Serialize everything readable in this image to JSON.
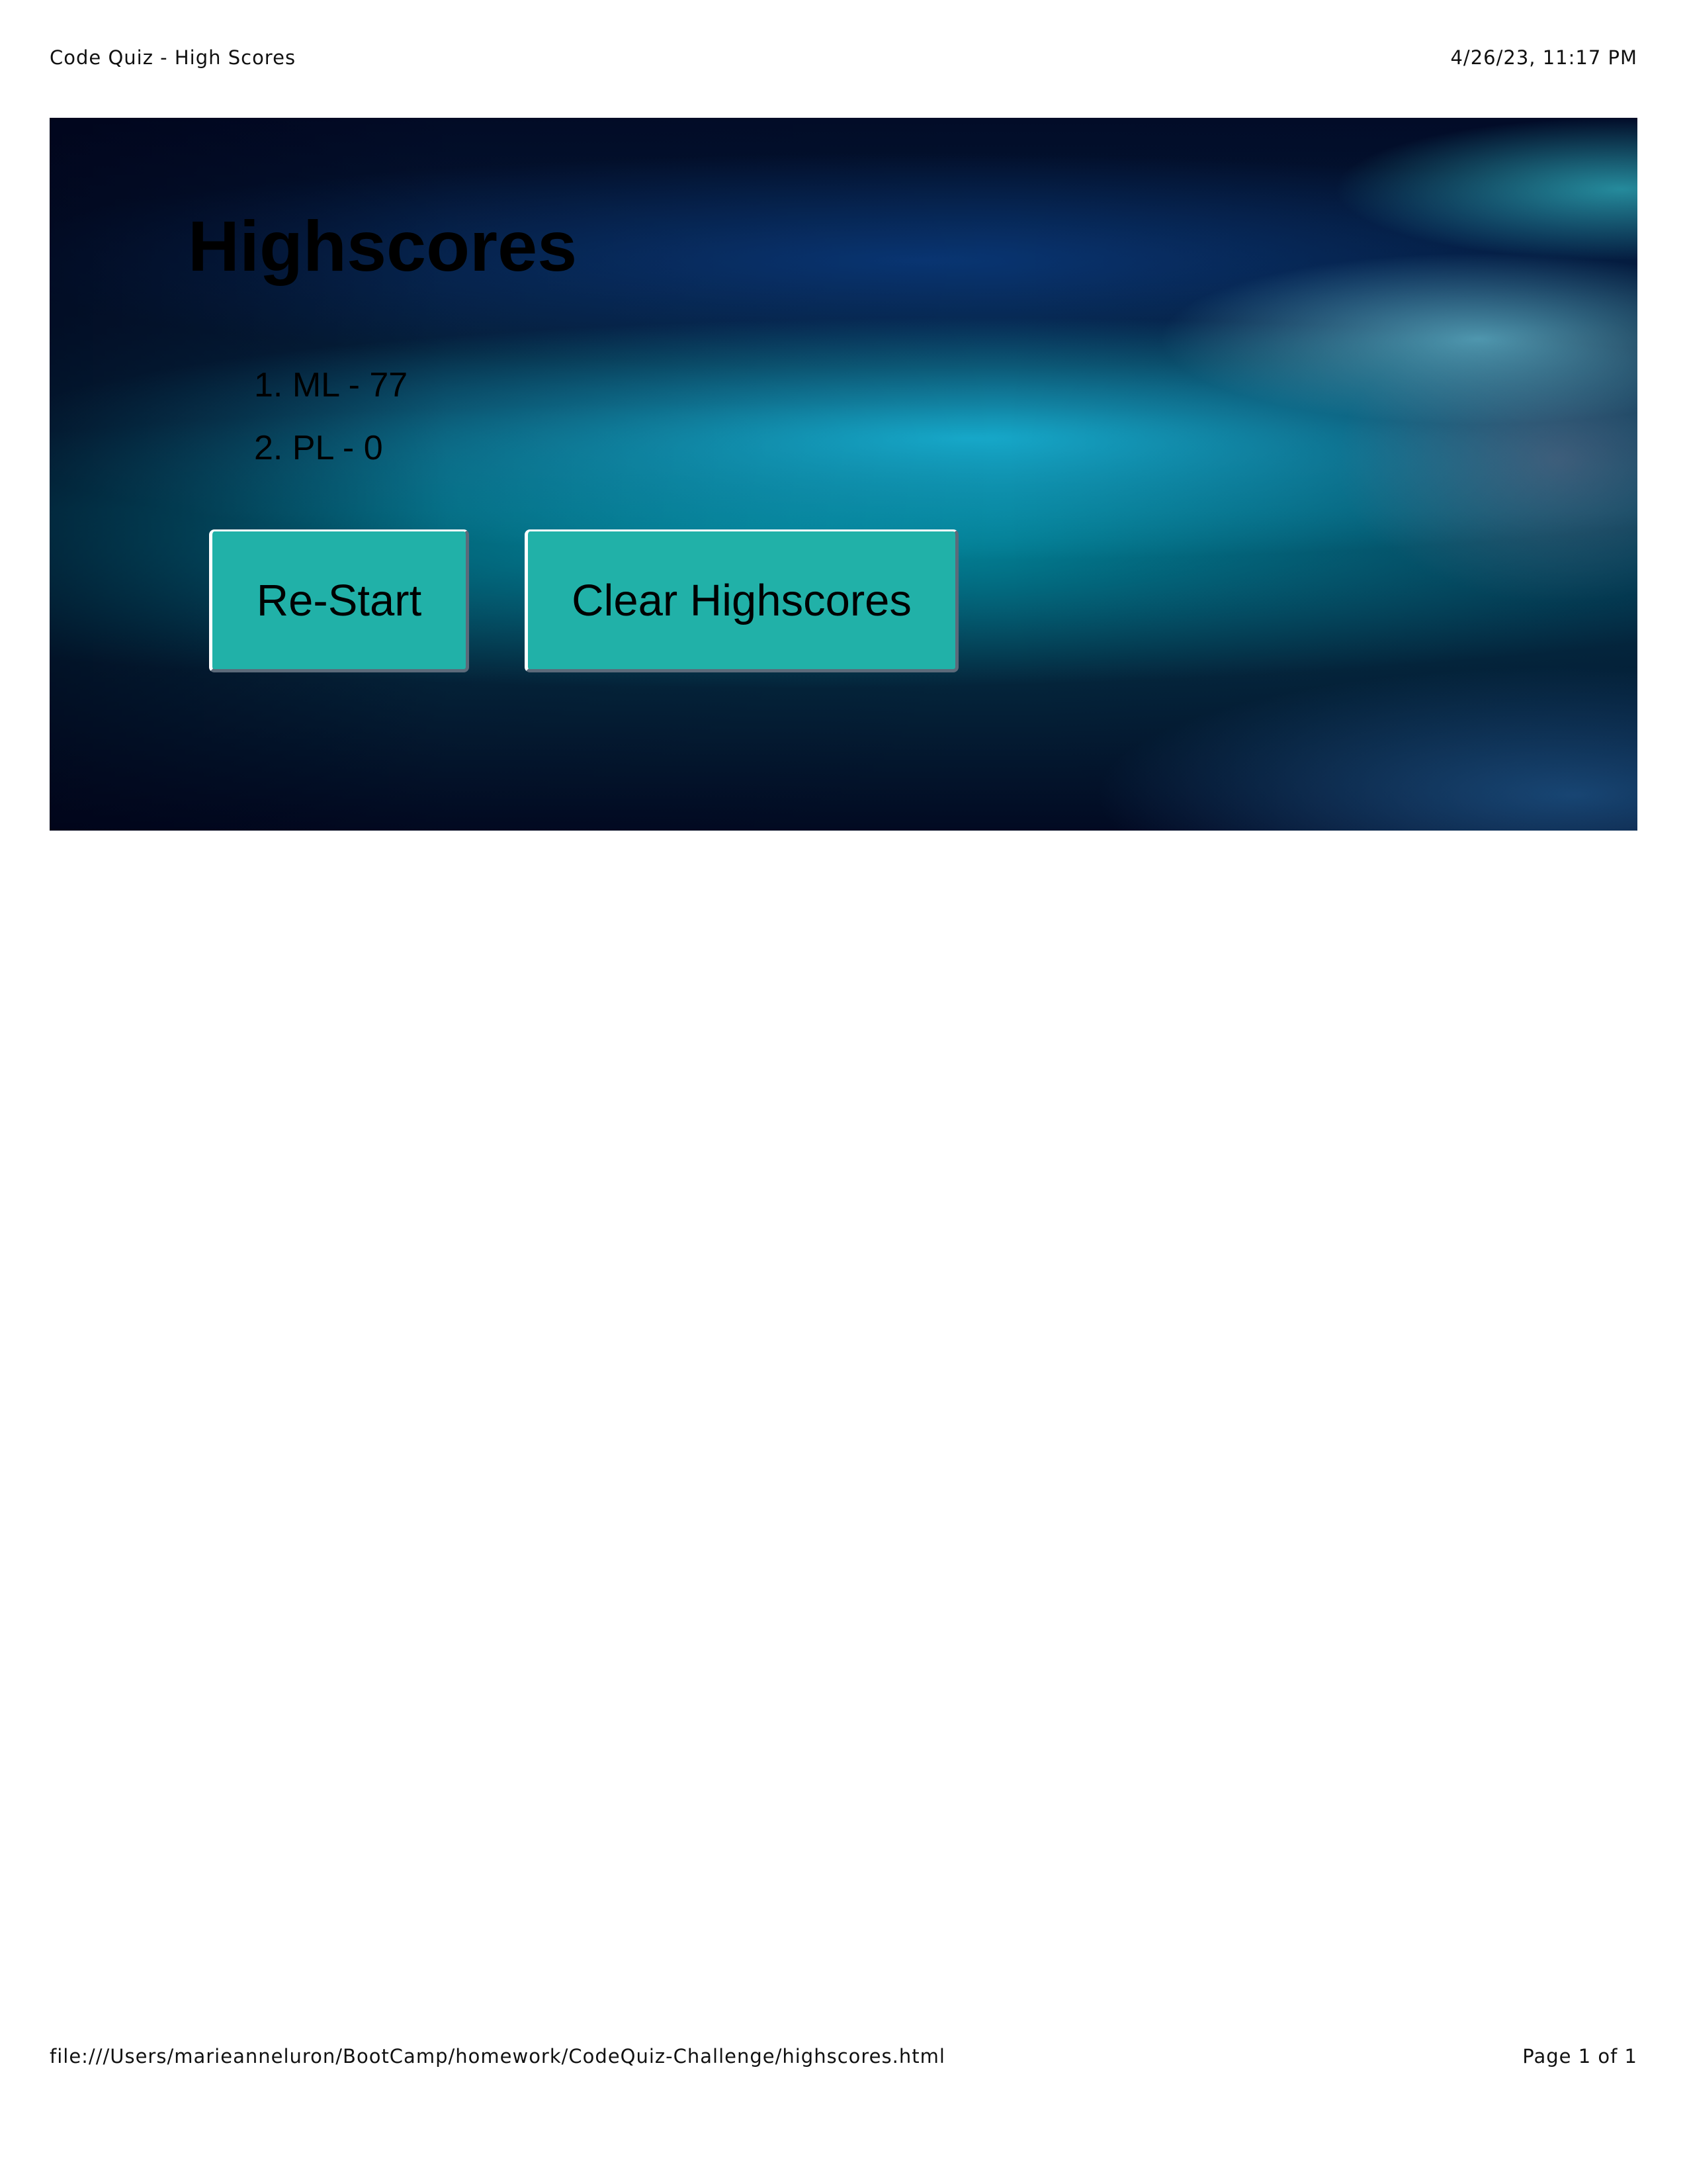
{
  "print_header": {
    "title": "Code Quiz - High Scores",
    "datetime": "4/26/23, 11:17 PM"
  },
  "page": {
    "heading": "Highscores",
    "scores": [
      "1. ML - 77",
      "2. PL - 0"
    ],
    "buttons": {
      "restart_label": "Re-Start",
      "clear_label": "Clear Highscores"
    }
  },
  "print_footer": {
    "url": "file:///Users/marieanneluron/BootCamp/homework/CodeQuiz-Challenge/highscores.html",
    "page_number": "Page 1 of 1"
  },
  "colors": {
    "button_background": "#21b1a8",
    "hero_dark": "#020c28",
    "hero_accent": "#19b9dc"
  }
}
